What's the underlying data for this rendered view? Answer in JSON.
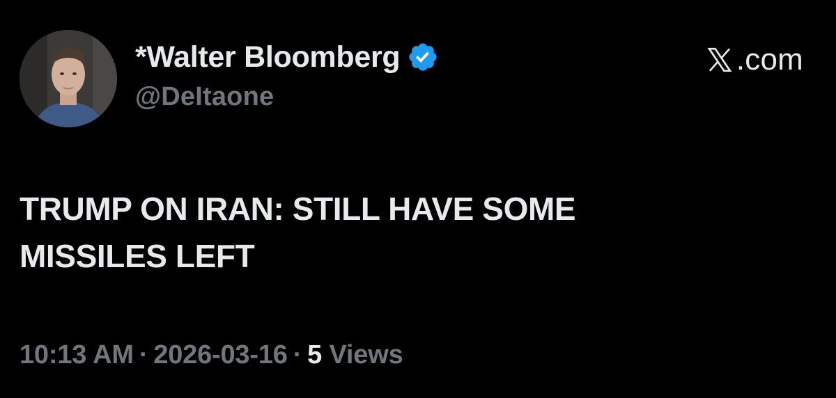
{
  "tweet": {
    "author": {
      "display_name": "*Walter Bloomberg",
      "handle": "@DeItaone",
      "verified": true
    },
    "watermark": "ᵔF.com",
    "watermark_suffix": ".com",
    "text_lines": [
      "TRUMP ON IRAN: STILL HAVE SOME",
      "MISSILES LEFT"
    ],
    "meta": {
      "time": "10:13 AM",
      "separator": "·",
      "date": "2026-03-16",
      "views_count": "5",
      "views_label": "Views"
    }
  },
  "colors": {
    "background": "#000000",
    "primary_text": "#e7e9ea",
    "secondary_text": "#71767b",
    "verified_badge": "#1d9bf0"
  },
  "icons": {
    "verified": "verified-badge-icon",
    "brand": "x-logo-icon"
  }
}
